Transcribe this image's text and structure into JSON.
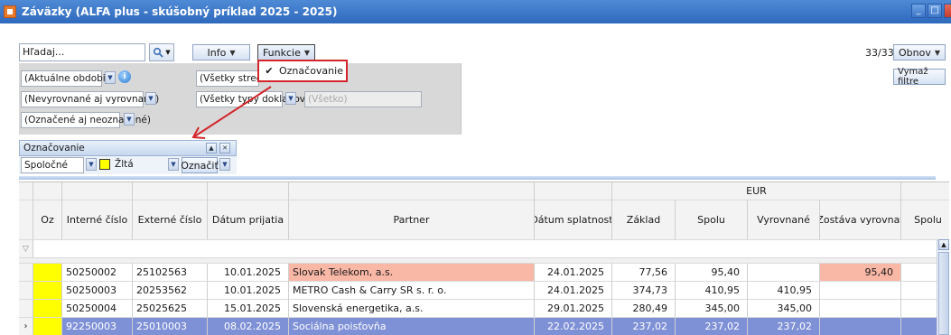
{
  "window": {
    "title": "Záväzky (ALFA plus - skúšobný príklad 2025 - 2025)"
  },
  "toolbar": {
    "search_value": "Hľadaj...",
    "info_label": "Info",
    "funkcie_label": "Funkcie",
    "page_count": "33/33",
    "obnov_label": "Obnov",
    "vymaz_filtre_label": "Vymaž filtre"
  },
  "filters": {
    "period": "(Aktuálne obdobie)",
    "strediska": "(Všetky strediská)",
    "vyrovnane": "(Nevyrovnané aj vyrovnané)",
    "typy_dokladov": "(Všetky typy dokladov)",
    "vsetko": "(Všetko)",
    "oznacene": "(Označené aj neoznačené)"
  },
  "funkcie_menu": {
    "items": [
      {
        "label": "Označovanie",
        "checked": true
      }
    ]
  },
  "oznacovanie_panel": {
    "title": "Označovanie",
    "scope": "Spoločné",
    "color_name": "Žltá",
    "color_hex": "#ffff00",
    "mark_label": "Označiť"
  },
  "grid": {
    "group_header": "EUR",
    "columns": [
      "Oz",
      "Interné číslo",
      "Externé číslo",
      "Dátum prijatia",
      "Partner",
      "Dátum splatnosti",
      "Základ",
      "Spolu",
      "Vyrovnané",
      "Zostáva vyrovnať",
      "Spolu"
    ],
    "rows": [
      {
        "interne": "50250002",
        "externe": "25102563",
        "prijatia": "10.01.2025",
        "partner": "Slovak Telekom, a.s.",
        "splatnosti": "24.01.2025",
        "zaklad": "77,56",
        "spolu": "95,40",
        "vyrovnane": "",
        "zostava": "95,40",
        "highlight": "#f9b7a6"
      },
      {
        "interne": "50250003",
        "externe": "20253562",
        "prijatia": "10.01.2025",
        "partner": "METRO Cash & Carry SR s. r. o.",
        "splatnosti": "24.01.2025",
        "zaklad": "374,73",
        "spolu": "410,95",
        "vyrovnane": "410,95",
        "zostava": "",
        "highlight": ""
      },
      {
        "interne": "50250004",
        "externe": "25025625",
        "prijatia": "15.01.2025",
        "partner": "Slovenská energetika, a.s.",
        "splatnosti": "29.01.2025",
        "zaklad": "280,49",
        "spolu": "345,00",
        "vyrovnane": "345,00",
        "zostava": "",
        "highlight": ""
      },
      {
        "interne": "92250003",
        "externe": "25010003",
        "prijatia": "08.02.2025",
        "partner": "Sociálna poisťovňa",
        "splatnosti": "22.02.2025",
        "zaklad": "237,02",
        "spolu": "237,02",
        "vyrovnane": "237,02",
        "zostava": "",
        "highlight": "selected"
      }
    ]
  },
  "colors": {
    "accent": "#2e69bd",
    "marker_yellow": "#ffff00",
    "row_highlight": "#f9b7a6",
    "selected_row": "#7f91d6",
    "arrow_red": "#d3252b"
  }
}
